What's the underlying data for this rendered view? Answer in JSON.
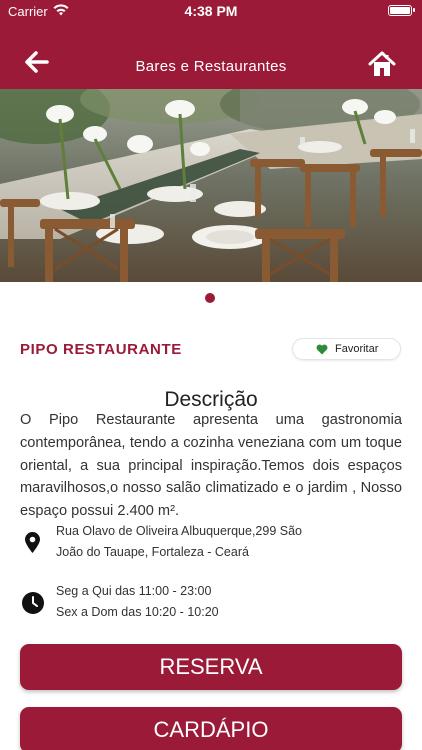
{
  "status_bar": {
    "carrier": "Carrier",
    "time": "4:38 PM"
  },
  "header": {
    "title": "Bares e Restaurantes",
    "back_icon": "arrow-left-icon",
    "home_icon": "home-icon"
  },
  "restaurant": {
    "name": "PIPO RESTAURANTE",
    "favorite_label": "Favoritar"
  },
  "description": {
    "title": "Descrição",
    "text": "O Pipo Restaurante apresenta uma gastronomia contemporânea, tendo a cozinha veneziana com um toque oriental, a sua principal inspiração.Temos dois espaços maravilhosos,o nosso salão climatizado e o jardim , Nosso espaço possui 2.400 m²."
  },
  "address": {
    "line1": "Rua Olavo de Oliveira Albuquerque,299 São",
    "line2": "João do Tauape, Fortaleza - Ceará"
  },
  "hours": {
    "line1": "Seg a Qui das 11:00 - 23:00",
    "line2": "Sex a Dom das 10:20 - 10:20"
  },
  "actions": {
    "reserve_label": "RESERVA",
    "menu_label": "CARDÁPIO"
  },
  "colors": {
    "brand": "#9b1a37",
    "favorite_heart": "#2e8b3a"
  }
}
